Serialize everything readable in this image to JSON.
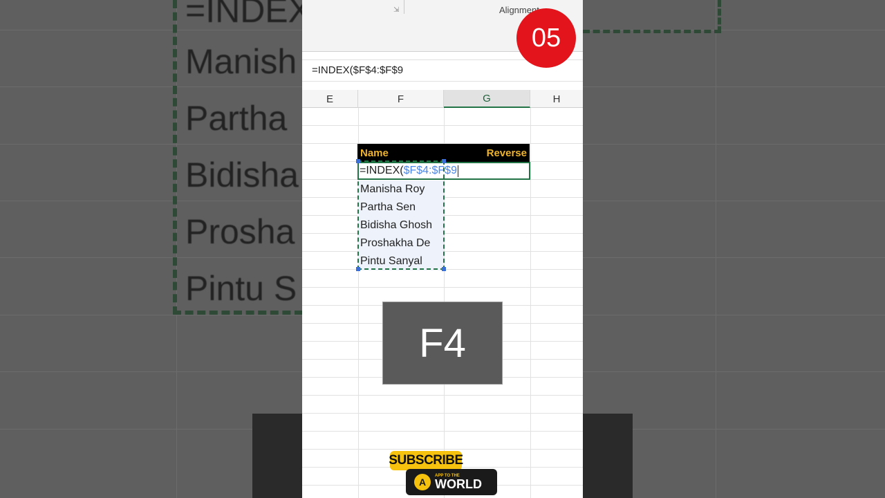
{
  "background": {
    "left_texts": [
      "=INDEX(",
      "Manish",
      "Partha",
      "Bidisha",
      "Prosha",
      "Pintu S"
    ]
  },
  "ribbon": {
    "group_label": "Alignment",
    "launcher_icon": "dialog-launcher-icon"
  },
  "step_badge": "05",
  "formula_bar": {
    "value": "=INDEX($F$4:$F$9"
  },
  "columns": [
    {
      "label": "E",
      "active": false
    },
    {
      "label": "F",
      "active": false
    },
    {
      "label": "G",
      "active": true
    },
    {
      "label": "H",
      "active": false
    }
  ],
  "table": {
    "header_left": "Name",
    "header_right": "Reverse",
    "edit_prefix": "=INDEX(",
    "edit_ref": "$F$4:$F$9",
    "names": [
      "Manisha Roy",
      "Partha Sen",
      "Bidisha Ghosh",
      "Proshakha De",
      "Pintu Sanyal"
    ]
  },
  "key_overlay": "F4",
  "promo": {
    "subscribe": "SUBSCRIBE",
    "brand_small": "APP TO THE",
    "brand_big": "WORLD"
  },
  "colors": {
    "accent_green": "#217346",
    "badge_red": "#e3141b",
    "header_gold": "#f0b429",
    "reference_blue": "#4a86e8"
  }
}
